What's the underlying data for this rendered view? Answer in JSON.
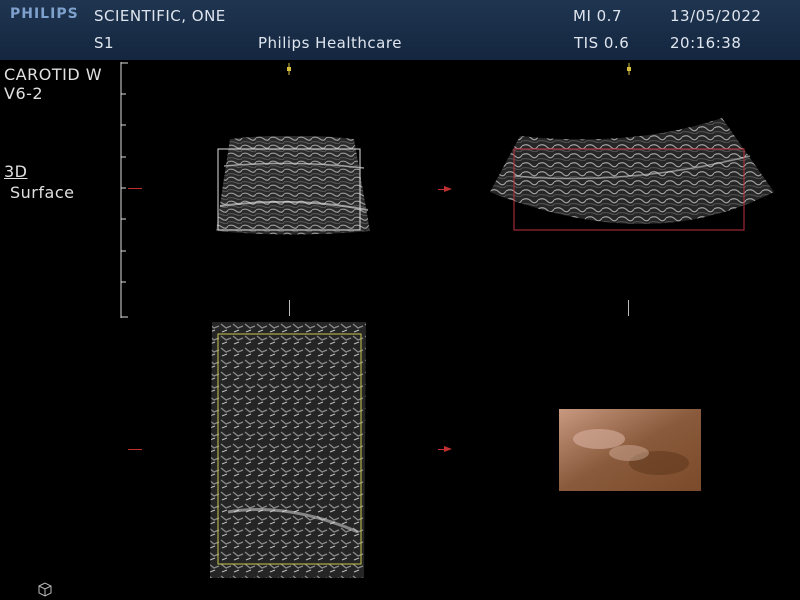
{
  "header": {
    "brand": "PHILIPS",
    "patient": "SCIENTIFIC, ONE",
    "mi": "MI 0.7",
    "date": "13/05/2022",
    "exam": "S1",
    "institution": "Philips Healthcare",
    "tis": "TIS 0.6",
    "time": "20:16:38"
  },
  "sidebar": {
    "preset": "CAROTID W",
    "transducer": "V6-2",
    "mode_top": "3D",
    "mode_bottom": "Surface"
  },
  "colors": {
    "header_bg": "#1a2d47",
    "roi_white": "#e0e0e0",
    "roi_red": "#c03040",
    "roi_yellow": "#c8c850",
    "marker_red": "#c03030",
    "marker_yellow": "#d8c040"
  },
  "icons": {
    "bottom_left": "3d-cube-icon"
  }
}
